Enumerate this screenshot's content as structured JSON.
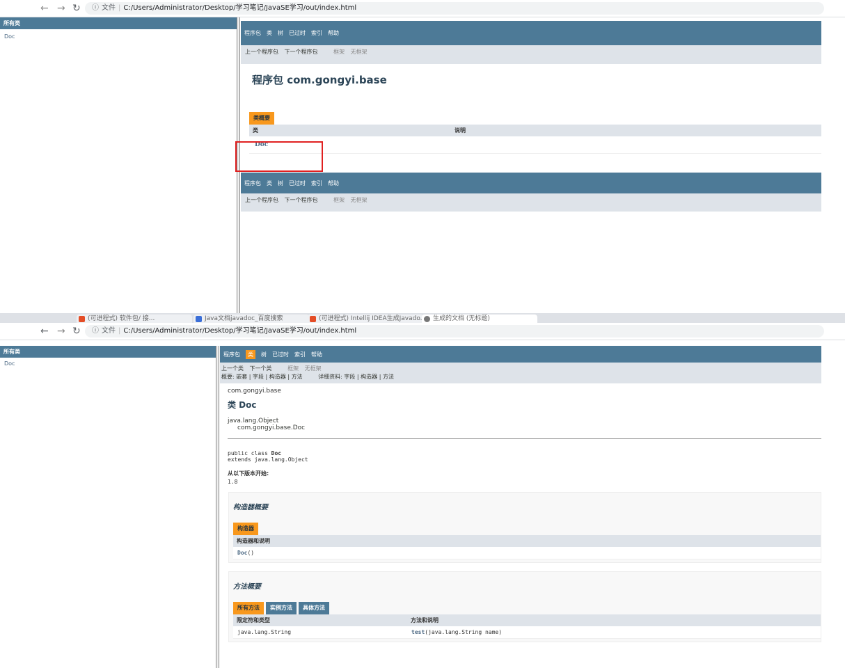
{
  "browser": {
    "url": "C:/Users/Administrator/Desktop/学习笔记/JavaSE学习/out/index.html",
    "file_label": "文件",
    "tabs": [
      "(可进程式) 软件包/ 接...",
      "Java文档javadoc_百度搜索",
      "(可进程式) Intellij IDEA生成Javado...",
      "生成的文档 (无标题)"
    ]
  },
  "left_frame": {
    "header": "所有类",
    "items": [
      "Doc"
    ]
  },
  "nav": {
    "items": [
      "程序包",
      "类",
      "树",
      "已过时",
      "索引",
      "帮助"
    ],
    "prev_package": "上一个程序包",
    "next_package": "下一个程序包",
    "prev_class": "上一个类",
    "next_class": "下一个类",
    "frames": "框架",
    "no_frames": "无框架",
    "summary_row": "概要: 嵌套 | 字段 | 构造器 | 方法",
    "detail_row": "详细资料: 字段 | 构造器 | 方法"
  },
  "package_page": {
    "title": "程序包 com.gongyi.base",
    "caption": "类概要",
    "col_class": "类",
    "col_desc": "说明",
    "rows": [
      {
        "name": "Doc",
        "desc": ""
      }
    ]
  },
  "class_page": {
    "package_name": "com.gongyi.base",
    "title": "类 Doc",
    "hierarchy_root": "java.lang.Object",
    "hierarchy_child": "com.gongyi.base.Doc",
    "sig_prefix": "public class ",
    "sig_class": "Doc",
    "sig_extends": "extends java.lang.Object",
    "since_label": "从以下版本开始:",
    "since_value": "1.8",
    "ctor_section": "构造器概要",
    "ctor_caption": "构造器",
    "ctor_col": "构造器和说明",
    "ctor_name": "Doc",
    "ctor_params": "()",
    "method_section": "方法概要",
    "method_tabs": [
      "所有方法",
      "实例方法",
      "具体方法"
    ],
    "method_col_type": "限定符和类型",
    "method_col_desc": "方法和说明",
    "method_rows": [
      {
        "type": "java.lang.String",
        "name": "test",
        "params": "(java.lang.String  name)"
      }
    ]
  },
  "colors": {
    "nav_blue": "#4d7a97",
    "sub_bg": "#dee3e9",
    "accent_orange": "#f8981d",
    "highlight_red": "#e02020"
  }
}
